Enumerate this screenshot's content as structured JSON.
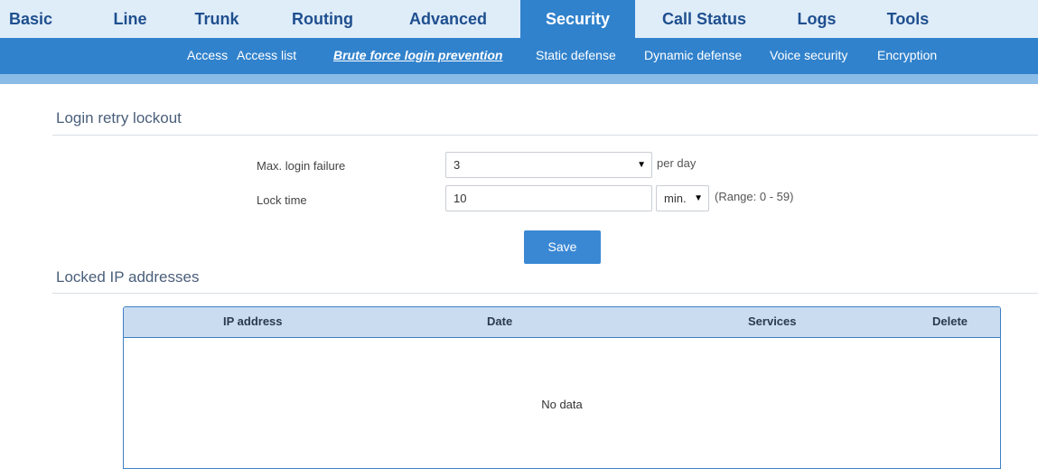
{
  "topnav": {
    "items": [
      "Basic",
      "Line",
      "Trunk",
      "Routing",
      "Advanced",
      "Security",
      "Call Status",
      "Logs",
      "Tools"
    ],
    "active": "Security"
  },
  "subnav": {
    "items": [
      "Access",
      "Access list",
      "Brute force login prevention",
      "Static defense",
      "Dynamic defense",
      "Voice security",
      "Encryption"
    ],
    "active": "Brute force login prevention"
  },
  "login_retry": {
    "title": "Login retry lockout",
    "max_failure_label": "Max. login failure",
    "max_failure_value": "3",
    "max_failure_unit": "per day",
    "lock_time_label": "Lock time",
    "lock_time_value": "10",
    "lock_time_unit": "min.",
    "lock_time_range": "(Range: 0 - 59)",
    "save_label": "Save"
  },
  "locked_ips": {
    "title": "Locked IP addresses",
    "columns": [
      "IP address",
      "Date",
      "Services",
      "Delete"
    ],
    "empty_text": "No data"
  },
  "colors": {
    "accent": "#3182cc",
    "nav_bg": "#dfedf9",
    "table_header": "#c9dcf0"
  }
}
